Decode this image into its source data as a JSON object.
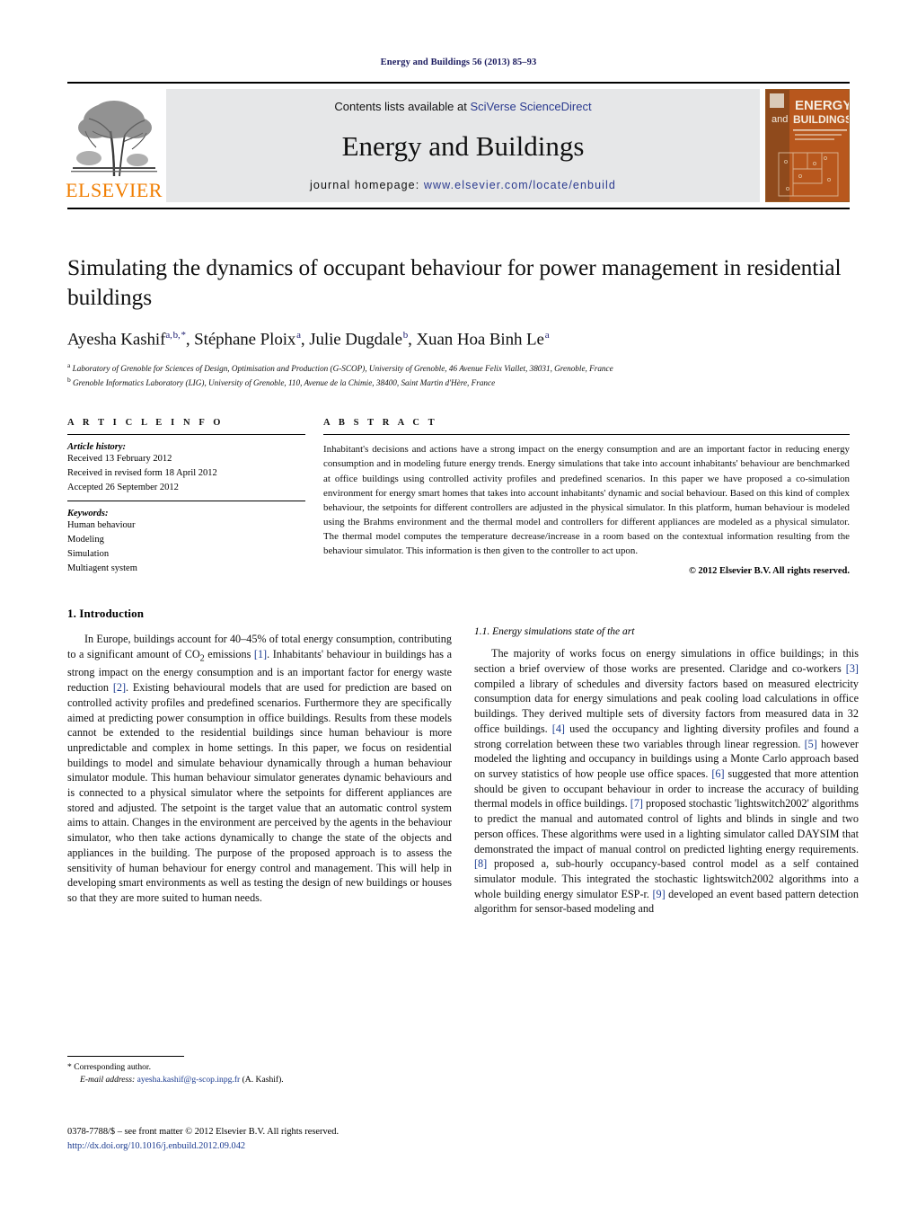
{
  "running_head": "Energy and Buildings 56 (2013) 85–93",
  "masthead": {
    "publisher_name": "ELSEVIER",
    "contents_prefix": "Contents lists available at ",
    "contents_link": "SciVerse ScienceDirect",
    "journal_name": "Energy and Buildings",
    "homepage_prefix": "journal homepage: ",
    "homepage_url": "www.elsevier.com/locate/enbuild",
    "cover": {
      "line1": "ENERGY",
      "line2": "and",
      "line3": "BUILDINGS"
    },
    "colors": {
      "band_bg": "#e6e7e8",
      "link_blue": "#2b3a8f",
      "elsevier_orange": "#f07d00",
      "cover_orange": "#b8571d",
      "running_head_navy": "#1a1a5e"
    }
  },
  "article": {
    "title": "Simulating the dynamics of occupant behaviour for power management in residential buildings",
    "authors_html": "Ayesha Kashif<sup>a,&#8202;b,&#8202;*</sup>, Stéphane Ploix<sup>&#8202;a</sup>, Julie Dugdale<sup>&#8202;b</sup>, Xuan Hoa Binh Le<sup>&#8202;a</sup>",
    "affiliations": [
      {
        "marker": "a",
        "text": "Laboratory of Grenoble for Sciences of Design, Optimisation and Production (G-SCOP), University of Grenoble, 46 Avenue Felix Viallet, 38031, Grenoble, France"
      },
      {
        "marker": "b",
        "text": "Grenoble Informatics Laboratory (LIG), University of Grenoble, 110, Avenue de la Chimie, 38400, Saint Martin d'Hère, France"
      }
    ]
  },
  "article_info": {
    "heading": "A R T I C L E    I N F O",
    "history_label": "Article history:",
    "history": [
      "Received 13 February 2012",
      "Received in revised form 18 April 2012",
      "Accepted 26 September 2012"
    ],
    "keywords_label": "Keywords:",
    "keywords": [
      "Human behaviour",
      "Modeling",
      "Simulation",
      "Multiagent system"
    ]
  },
  "abstract": {
    "heading": "A B S T R A C T",
    "text": "Inhabitant's decisions and actions have a strong impact on the energy consumption and are an important factor in reducing energy consumption and in modeling future energy trends. Energy simulations that take into account inhabitants' behaviour are benchmarked at office buildings using controlled activity profiles and predefined scenarios. In this paper we have proposed a co-simulation environment for energy smart homes that takes into account inhabitants' dynamic and social behaviour. Based on this kind of complex behaviour, the setpoints for different controllers are adjusted in the physical simulator. In this platform, human behaviour is modeled using the Brahms environment and the thermal model and controllers for different appliances are modeled as a physical simulator. The thermal model computes the temperature decrease/increase in a room based on the contextual information resulting from the behaviour simulator. This information is then given to the controller to act upon.",
    "copyright": "© 2012 Elsevier B.V. All rights reserved."
  },
  "sections": {
    "intro_heading": "1.  Introduction",
    "intro_para_html": "In Europe, buildings account for 40&#8211;45% of total energy consumption, contributing to a significant amount of CO<sub>2</sub> emissions <span class=\"cite\">[1]</span>. Inhabitants' behaviour in buildings has a strong impact on the energy consumption and is an important factor for energy waste reduction <span class=\"cite\">[2]</span>. Existing behavioural models that are used for prediction are based on controlled activity profiles and predefined scenarios. Furthermore they are specifically aimed at predicting power consumption in office buildings. Results from these models cannot be extended to the residential buildings since human behaviour is more unpredictable and complex in home settings. In this paper, we focus on residential buildings to model and simulate behaviour dynamically through a human behaviour simulator module. This human behaviour simulator generates dynamic behaviours and is connected to a physical simulator where the setpoints for different appliances are stored and adjusted. The setpoint is the target value that an automatic control system aims to attain. Changes in the environment are perceived by the agents in the behaviour simulator, who then take actions dynamically to change the state of the objects and appliances in the building. The purpose of the proposed approach is to assess the sensitivity of human behaviour for energy control and management. This will help in developing smart environments as well as testing the design of new buildings or houses so that they are more suited to human needs.",
    "subsec_heading": "1.1.  Energy simulations state of the art",
    "subsec_para_html": "The majority of works focus on energy simulations in office buildings; in this section a brief overview of those works are presented. Claridge and co-workers <span class=\"cite\">[3]</span> compiled a library of schedules and diversity factors based on measured electricity consumption data for energy simulations and peak cooling load calculations in office buildings. They derived multiple sets of diversity factors from measured data in 32 office buildings. <span class=\"cite\">[4]</span> used the occupancy and lighting diversity profiles and found a strong correlation between these two variables through linear regression. <span class=\"cite\">[5]</span> however modeled the lighting and occupancy in buildings using a Monte Carlo approach based on survey statistics of how people use office spaces. <span class=\"cite\">[6]</span> suggested that more attention should be given to occupant behaviour in order to increase the accuracy of building thermal models in office buildings. <span class=\"cite\">[7]</span> proposed stochastic 'lightswitch2002' algorithms to predict the manual and automated control of lights and blinds in single and two person offices. These algorithms were used in a lighting simulator called DAYSIM that demonstrated the impact of manual control on predicted lighting energy requirements. <span class=\"cite\">[8]</span> proposed a, sub-hourly occupancy-based control model as a self contained simulator module. This integrated the stochastic lightswitch2002 algorithms into a whole building energy simulator ESP-r. <span class=\"cite\">[9]</span> developed an event based pattern detection algorithm for sensor-based modeling and"
  },
  "footnote": {
    "corresponding": "*  Corresponding author.",
    "email_label": "E-mail address:",
    "email": "ayesha.kashif@g-scop.inpg.fr",
    "email_suffix": " (A. Kashif)."
  },
  "footer": {
    "issn_line": "0378-7788/$ – see front matter © 2012 Elsevier B.V. All rights reserved.",
    "doi": "http://dx.doi.org/10.1016/j.enbuild.2012.09.042"
  }
}
